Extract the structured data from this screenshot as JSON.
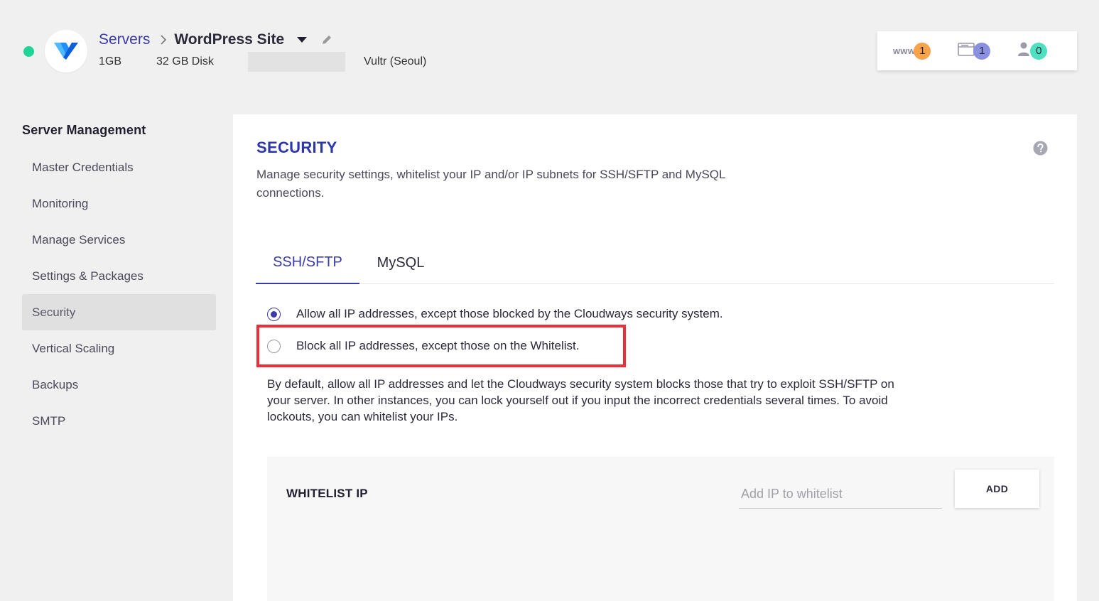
{
  "header": {
    "breadcrumb_root": "Servers",
    "app_name": "WordPress Site",
    "ram": "1GB",
    "disk": "32 GB Disk",
    "provider": "Vultr (Seoul)"
  },
  "stats": {
    "www_label": "www",
    "www_count": "1",
    "files_count": "1",
    "users_count": "0"
  },
  "sidebar": {
    "title": "Server Management",
    "items": [
      {
        "label": "Master Credentials"
      },
      {
        "label": "Monitoring"
      },
      {
        "label": "Manage Services"
      },
      {
        "label": "Settings & Packages"
      },
      {
        "label": "Security",
        "active": true
      },
      {
        "label": "Vertical Scaling"
      },
      {
        "label": "Backups"
      },
      {
        "label": "SMTP"
      }
    ]
  },
  "security": {
    "title": "SECURITY",
    "description": "Manage security settings, whitelist your IP and/or IP subnets for SSH/SFTP and MySQL connections.",
    "tabs": [
      {
        "label": "SSH/SFTP",
        "active": true
      },
      {
        "label": "MySQL"
      }
    ],
    "options": [
      {
        "label": "Allow all IP addresses, except those blocked by the Cloudways security system.",
        "checked": true
      },
      {
        "label": "Block all IP addresses, except those on the Whitelist.",
        "checked": false
      }
    ],
    "note": "By default, allow all IP addresses and let the Cloudways security system blocks those that try to exploit SSH/SFTP on your server. In other instances, you can lock yourself out if you input the incorrect credentials several times. To avoid lockouts, you can whitelist your IPs.",
    "whitelist": {
      "title": "WHITELIST IP",
      "input_placeholder": "Add IP to whitelist",
      "input_value": "",
      "add_label": "ADD"
    }
  },
  "colors": {
    "accent": "#3a3aa8",
    "status_online": "#1ed496",
    "highlight": "#e8303a"
  }
}
